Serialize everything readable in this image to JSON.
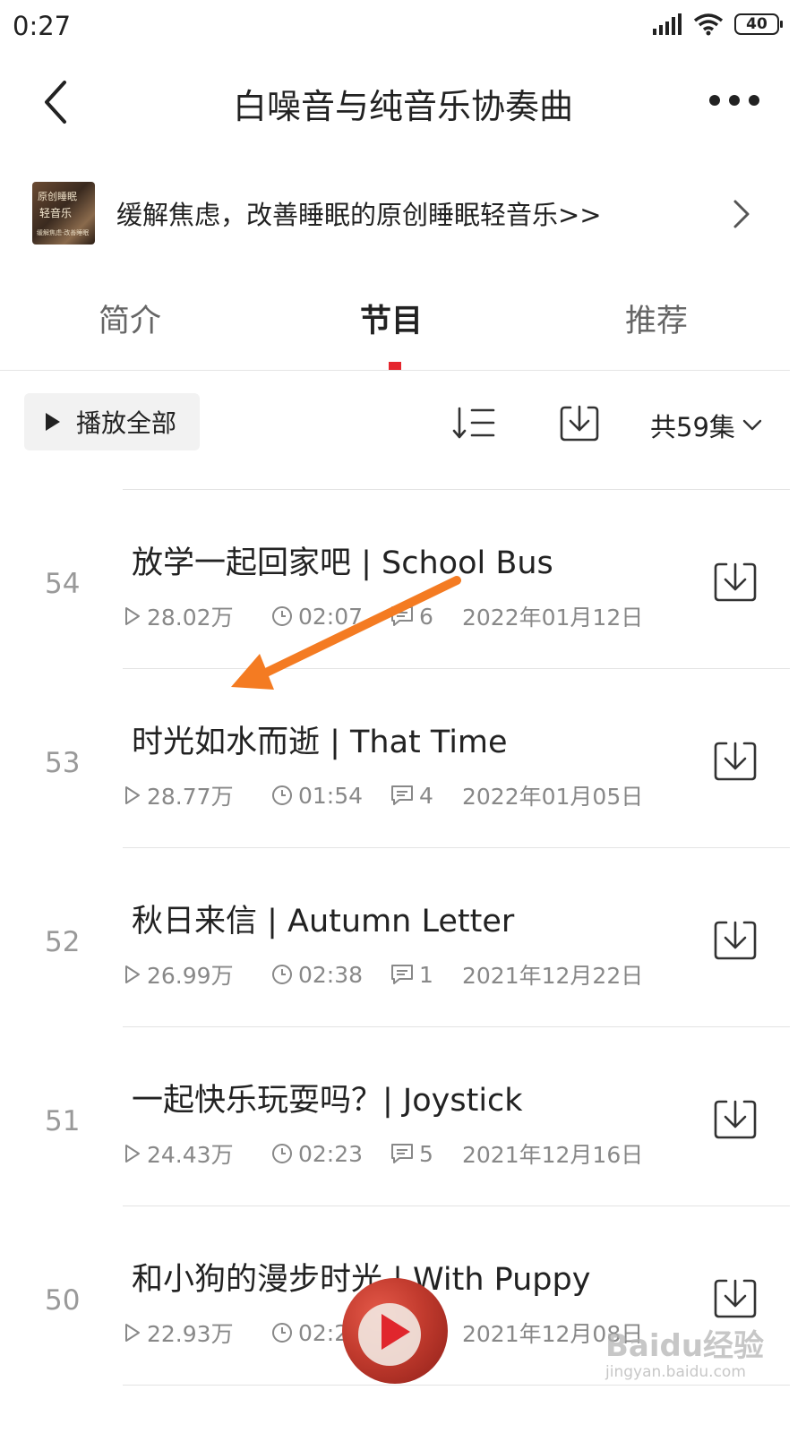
{
  "status_bar": {
    "time": "0:27",
    "battery": "40"
  },
  "nav": {
    "title": "白噪音与纯音乐协奏曲"
  },
  "banner": {
    "text": "缓解焦虑，改善睡眠的原创睡眠轻音乐>>",
    "thumb_line1": "原创睡眠",
    "thumb_line2": "轻音乐",
    "thumb_line3": "缓解焦虑·改善睡眠"
  },
  "tabs": [
    {
      "label": "简介",
      "active": false
    },
    {
      "label": "节目",
      "active": true
    },
    {
      "label": "推荐",
      "active": false
    }
  ],
  "toolbar": {
    "play_all_label": "播放全部",
    "episode_count": "共59集"
  },
  "episodes": [
    {
      "num": "54",
      "title": "放学一起回家吧 | School Bus",
      "plays": "28.02万",
      "duration": "02:07",
      "comments": "6",
      "date": "2022年01月12日"
    },
    {
      "num": "53",
      "title": "时光如水而逝 | That Time",
      "plays": "28.77万",
      "duration": "01:54",
      "comments": "4",
      "date": "2022年01月05日"
    },
    {
      "num": "52",
      "title": "秋日来信 | Autumn Letter",
      "plays": "26.99万",
      "duration": "02:38",
      "comments": "1",
      "date": "2021年12月22日"
    },
    {
      "num": "51",
      "title": "一起快乐玩耍吗？| Joystick",
      "plays": "24.43万",
      "duration": "02:23",
      "comments": "5",
      "date": "2021年12月16日"
    },
    {
      "num": "50",
      "title": "和小狗的漫步时光 | With Puppy",
      "plays": "22.93万",
      "duration": "02:2",
      "comments": "",
      "date": "2021年12月08日"
    }
  ],
  "watermark": {
    "main": "Baidu经验",
    "sub": "jingyan.baidu.com"
  },
  "colors": {
    "accent": "#e5262e",
    "annotation_arrow": "#f47b22",
    "text_primary": "#222222",
    "text_secondary": "#888888"
  },
  "icons": {
    "back": "chevron-left-icon",
    "more": "more-dots-icon",
    "banner_arrow": "chevron-right-icon",
    "sort": "sort-icon",
    "download": "download-icon",
    "play": "play-icon",
    "clock": "clock-icon",
    "comment": "comment-icon",
    "expand": "chevron-down-icon"
  }
}
